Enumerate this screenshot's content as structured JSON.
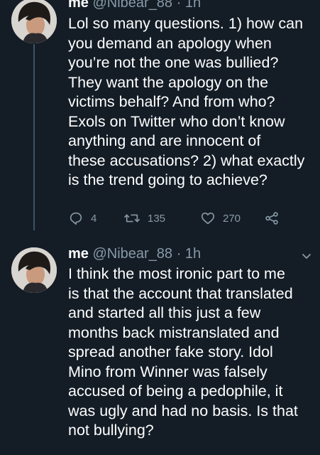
{
  "tweet1": {
    "name": "me",
    "handle": "@Nibear_88",
    "separator": "·",
    "time": "1h",
    "text_lines": [
      "Lol so many questions. 1) how can",
      "you demand an apology when",
      "you’re not the one was bullied?",
      "They want the apology on the",
      "victims behalf? And from who?",
      "Exols on Twitter who don’t know",
      "anything and are innocent of",
      "these accusations? 2) what exactly",
      "is the trend going to achieve?"
    ],
    "actions": {
      "reply_icon": "reply-icon",
      "reply_count": "4",
      "retweet_icon": "retweet-icon",
      "retweet_count": "135",
      "like_icon": "heart-icon",
      "like_count": "270",
      "share_icon": "share-icon"
    }
  },
  "tweet2": {
    "name": "me",
    "handle": "@Nibear_88",
    "separator": "·",
    "time": "1h",
    "text_lines": [
      "I think the most ironic part to me",
      "is that the account that translated",
      "and started all this just a few",
      "months back mistranslated and",
      "spread another fake story. Idol",
      "Mino from Winner was falsely",
      "accused of being a pedophile, it",
      "was ugly and had no basis. Is that",
      "not bullying?"
    ]
  },
  "colors": {
    "background": "#141d26",
    "text": "#ffffff",
    "muted": "#8899a6",
    "thread_line": "#3d5466"
  }
}
